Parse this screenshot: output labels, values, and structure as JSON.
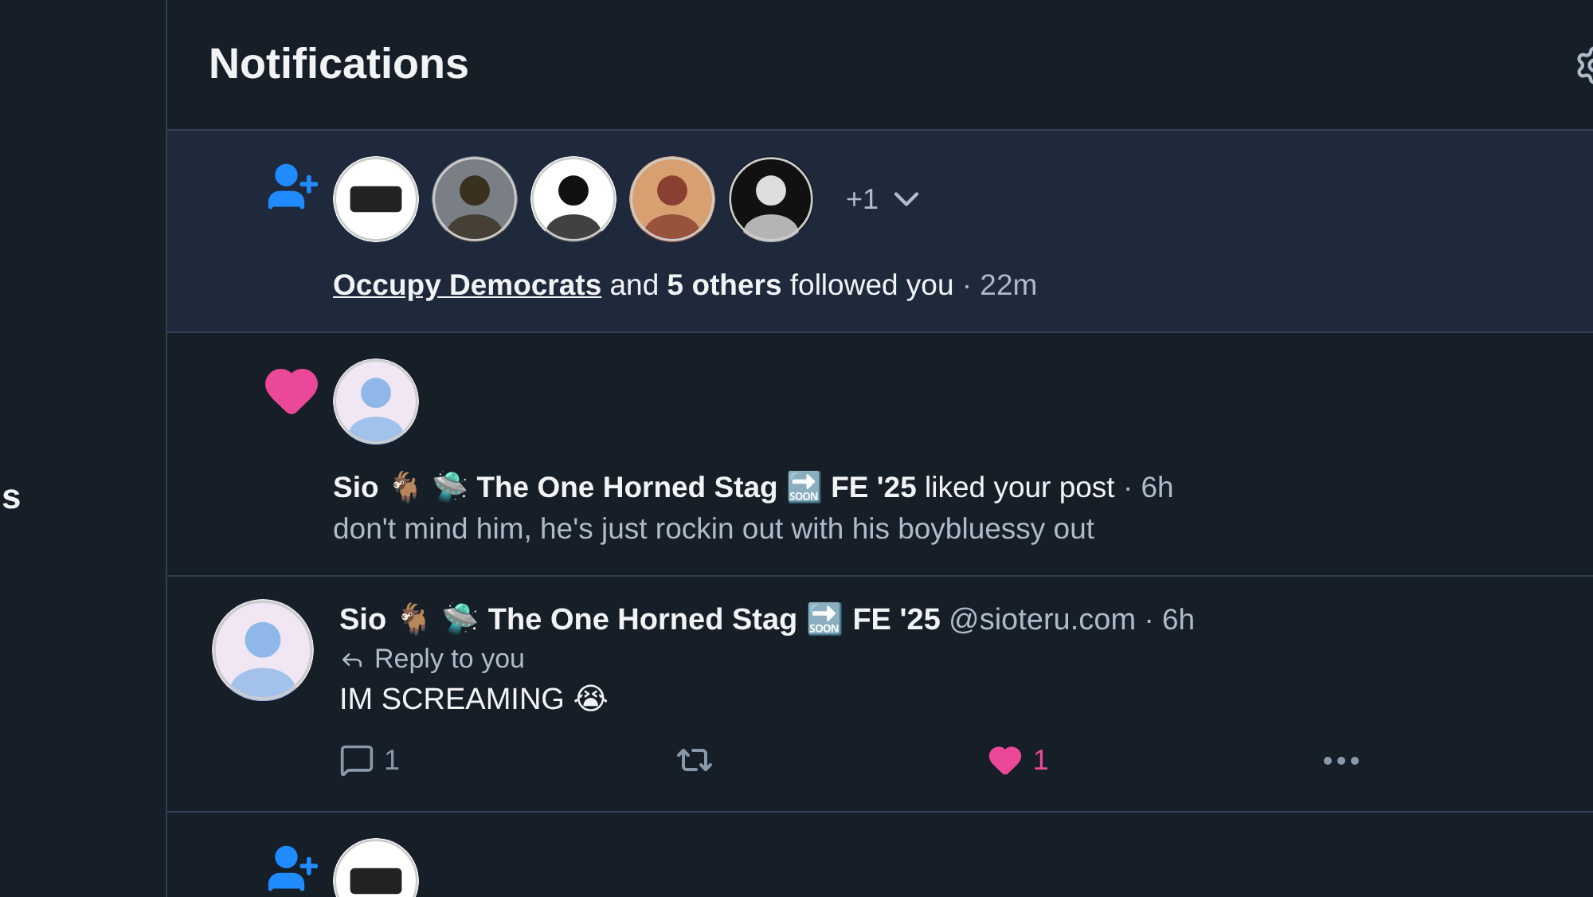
{
  "sidebar": {
    "items": [
      {
        "label": "s"
      }
    ]
  },
  "header": {
    "title": "Notifications"
  },
  "notifications": [
    {
      "kind": "follow",
      "unread": true,
      "more_count": "+1",
      "expanded": false,
      "actor": "Occupy Democrats",
      "text": "and **5 others** followed you",
      "time": "· 22m"
    },
    {
      "kind": "like",
      "unread": false,
      "text": "**Sio 🐐 🛸 The One Horned Stag 🔜 FE '25** liked your post",
      "time": "· 6h",
      "snippet": "don't mind him, he's just rockin out with his boybluessy out"
    },
    {
      "kind": "post",
      "author": "Sio 🐐 🛸 The One Horned Stag 🔜 FE '25",
      "handle": "@sioteru.com",
      "time": "· 6h",
      "reply_to": "Reply to you",
      "text": "IM SCREAMING 😭",
      "replies": "1",
      "reposted": false,
      "liked": true,
      "likes": "1"
    },
    {
      "kind": "follow"
    }
  ]
}
